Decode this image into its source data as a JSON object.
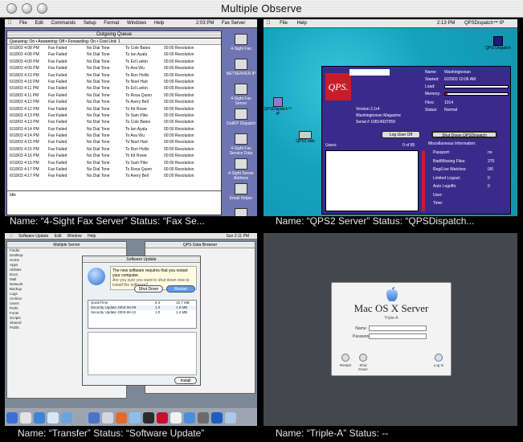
{
  "window": {
    "title": "Multiple Observe"
  },
  "observers": [
    {
      "name_caption": "Name: “4-Sight Fax Server”   Status: “Fax Se...",
      "menubar": [
        "File",
        "Edit",
        "Commands",
        "Setup",
        "Format",
        "Windows",
        "Help"
      ],
      "clock": "2:03 PM",
      "app_label": "Fax Server",
      "queue_window_title": "Outgoing Queue",
      "queue_header": "Queueing: On  •  Answering: Off  •  Forwarding: On  •  Cost Unit: 1",
      "rows": [
        [
          "6/18/03 4:08 PM",
          "Fax Failed",
          "No Dial Tone",
          "To Cole Bates",
          "00:00 Resolution"
        ],
        [
          "6/18/03 4:08 PM",
          "Fax Failed",
          "No Dial Tone",
          "To Ian Ayala",
          "00:00 Resolution"
        ],
        [
          "6/18/03 4:09 PM",
          "Fax Failed",
          "No Dial Tone",
          "To Ed Larkin",
          "00:00 Resolution"
        ],
        [
          "6/18/03 4:09 PM",
          "Fax Failed",
          "No Dial Tone",
          "To Ava Wu",
          "00:00 Resolution"
        ],
        [
          "6/18/03 4:10 PM",
          "Fax Failed",
          "No Dial Tone",
          "To Ron Hollis",
          "00:00 Resolution"
        ],
        [
          "6/18/03 4:10 PM",
          "Fax Failed",
          "No Dial Tone",
          "To Noel Hart",
          "00:00 Resolution"
        ],
        [
          "6/18/03 4:11 PM",
          "Fax Failed",
          "No Dial Tone",
          "To Ed Larkin",
          "00:00 Resolution"
        ],
        [
          "6/18/03 4:11 PM",
          "Fax Failed",
          "No Dial Tone",
          "To Rosa Quinn",
          "00:00 Resolution"
        ],
        [
          "6/18/03 4:12 PM",
          "Fax Failed",
          "No Dial Tone",
          "To Avery Bell",
          "00:00 Resolution"
        ],
        [
          "6/18/03 4:12 PM",
          "Fax Failed",
          "No Dial Tone",
          "To Kit Rowe",
          "00:00 Resolution"
        ],
        [
          "6/18/03 4:13 PM",
          "Fax Failed",
          "No Dial Tone",
          "To Sam Pike",
          "00:00 Resolution"
        ],
        [
          "6/18/03 4:13 PM",
          "Fax Failed",
          "No Dial Tone",
          "To Cole Bates",
          "00:00 Resolution"
        ],
        [
          "6/18/03 4:14 PM",
          "Fax Failed",
          "No Dial Tone",
          "To Ian Ayala",
          "00:00 Resolution"
        ],
        [
          "6/18/03 4:14 PM",
          "Fax Failed",
          "No Dial Tone",
          "To Ava Wu",
          "00:00 Resolution"
        ],
        [
          "6/18/03 4:15 PM",
          "Fax Failed",
          "No Dial Tone",
          "To Noel Hart",
          "00:00 Resolution"
        ],
        [
          "6/18/03 4:15 PM",
          "Fax Failed",
          "No Dial Tone",
          "To Ron Hollis",
          "00:00 Resolution"
        ],
        [
          "6/18/03 4:16 PM",
          "Fax Failed",
          "No Dial Tone",
          "To Kit Rowe",
          "00:00 Resolution"
        ],
        [
          "6/18/03 4:16 PM",
          "Fax Failed",
          "No Dial Tone",
          "To Sam Pike",
          "00:00 Resolution"
        ],
        [
          "6/18/03 4:17 PM",
          "Fax Failed",
          "No Dial Tone",
          "To Rosa Quinn",
          "00:00 Resolution"
        ],
        [
          "6/18/03 4:17 PM",
          "Fax Failed",
          "No Dial Tone",
          "To Avery Bell",
          "00:00 Resolution"
        ]
      ],
      "log_label": "Idle",
      "desktop_icons": [
        "4-Sight Fax",
        "NETSERVER IP",
        "4-Sight Fax Server",
        "OutlFP Dispatch",
        "4-Sight Fax Service Data",
        "4-Sight Server Address",
        "Email Helper",
        "Trash"
      ]
    },
    {
      "name_caption": "Name: “QPS2 Server”   Status: “QPSDispatch...",
      "menubar": [
        "File",
        "Help"
      ],
      "clock": "2:13 PM",
      "app_label": "QPSDispatch™ IP",
      "desktop_icons": [
        "QPS Dispatch",
        "QPSDispatch™ IP",
        "QPS2 disk"
      ],
      "logo_text": "QPS.",
      "version": "Version 2.1r4",
      "publication": "Washingtonian Magazine",
      "serial": "Serial # 10814937059",
      "name_label": "Name:",
      "name_value": "Washingtonian",
      "started_label": "Started:",
      "started_value": "6/20/03 10:06 AM",
      "load_label": "Load:",
      "memory_label": "Memory:",
      "files_label": "Files:",
      "files_value": "1014",
      "status_label": "Status:",
      "status_value": "Normal",
      "logout_button": "Log User Off",
      "shutdown_button": "Shut Down QPSDispatch",
      "users_label": "Users:",
      "users_count": "0 of 85",
      "misc_title": "Miscellaneous Information:",
      "misc": [
        {
          "label": "Passport:",
          "value": "no"
        },
        {
          "label": "Bad/Missing Files:",
          "value": "270"
        },
        {
          "label": "Reg/Live Watches:",
          "value": "0/0"
        },
        {
          "label": "Limited Logout:",
          "value": "0"
        },
        {
          "label": "Auto Logoffs:",
          "value": "0"
        },
        {
          "label": "User:",
          "value": ""
        },
        {
          "label": "Time:",
          "value": ""
        }
      ]
    },
    {
      "name_caption": "Name: “Transfer”   Status: “Software Update”",
      "menubar": [
        "Software Update",
        "Edit",
        "Window",
        "Help"
      ],
      "clock": "Sun 2:11 PM",
      "window1_title": "Multiple Server",
      "window2_title": "QPS Data Browser",
      "sheet_title": "Software Update",
      "sheet_message": "The new software requires that you restart your computer.",
      "sheet_sub": "Are you sure you want to shut down now to install the software?",
      "sheet_cancel": "Shut Down",
      "sheet_ok": "Restart",
      "updates": [
        {
          "name": "QuickTime",
          "version": "6.3",
          "size": "15.7 MB"
        },
        {
          "name": "Security Update 2003-06-09",
          "version": "1.0",
          "size": "1.6 MB"
        },
        {
          "name": "Security Update 2003-06-12",
          "version": "1.0",
          "size": "1.4 MB"
        }
      ],
      "install_button": "Install",
      "sidebar_items": [
        "Finder",
        "Desktop",
        "Home",
        "Apps",
        "Utilities",
        "Docs",
        "Mail",
        "Network",
        "Backup",
        "Logs",
        "Archive",
        "Users",
        "Prefs",
        "Fonts",
        "Scripts",
        "Shared",
        "Public"
      ]
    },
    {
      "name_caption": "Name: “Triple-A”   Status: --",
      "dialog_title": "Mac OS X Server",
      "dialog_sub": "Triple-A",
      "name_label": "Name:",
      "password_label": "Password:",
      "buttons": [
        "Restart",
        "Shut Down",
        "Log In"
      ]
    }
  ],
  "colors": {
    "fax_desktop": "#6f75b2",
    "qps_desktop": "#17a9c4",
    "qps_panel": "#3a2b8b",
    "qps_logo": "#c81c2b",
    "transfer_desktop": "#7d8897",
    "triple_a_desktop": "#45474c"
  }
}
